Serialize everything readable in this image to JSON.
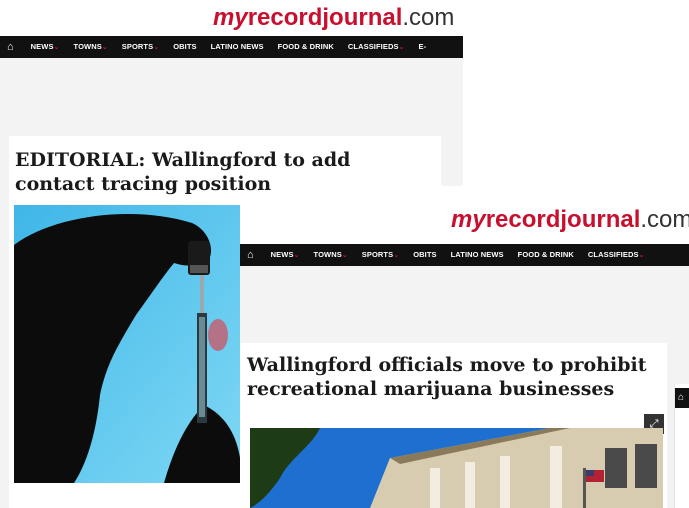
{
  "site": {
    "logo_my": "my",
    "logo_record": "recordjournal",
    "logo_com": ".com"
  },
  "nav": {
    "items": [
      {
        "label": "NEWS",
        "dropdown": true
      },
      {
        "label": "TOWNS",
        "dropdown": true
      },
      {
        "label": "SPORTS",
        "dropdown": true
      },
      {
        "label": "OBITS",
        "dropdown": false
      },
      {
        "label": "LATINO NEWS",
        "dropdown": false
      },
      {
        "label": "FOOD & DRINK",
        "dropdown": false
      },
      {
        "label": "CLASSIFIEDS",
        "dropdown": true
      },
      {
        "label": "E-",
        "dropdown": false
      }
    ],
    "caret": "⌄",
    "home_icon": "home-icon"
  },
  "articles": [
    {
      "headline": "EDITORIAL: Wallingford to add contact tracing position",
      "image": "syringe-vial-photo"
    },
    {
      "headline": "Wallingford officials move to prohibit recreational marijuana businesses",
      "image": "town-hall-building-photo"
    }
  ],
  "colors": {
    "brand_red": "#c8102e",
    "nav_bg": "#111111",
    "page_gray": "#f3f3f3"
  }
}
